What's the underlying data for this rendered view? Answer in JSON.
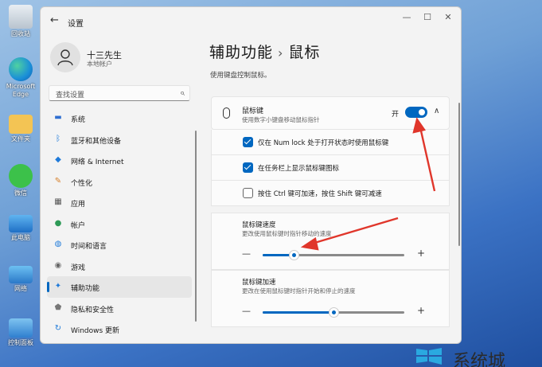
{
  "desktop": {
    "icons": [
      {
        "label": "回收站"
      },
      {
        "label": "Microsoft Edge"
      },
      {
        "label": "文件夹"
      },
      {
        "label": "微信"
      },
      {
        "label": "此电脑"
      },
      {
        "label": "网络"
      },
      {
        "label": "控制面板"
      }
    ]
  },
  "window": {
    "title": "设置",
    "back": "←",
    "minimize": "—",
    "maximize": "☐",
    "close": "✕"
  },
  "profile": {
    "name": "十三先生",
    "type": "本地帐户"
  },
  "search": {
    "placeholder": "查找设置"
  },
  "nav": {
    "items": [
      {
        "label": "系统",
        "icon": "monitor-icon",
        "color": "#2f6fd1"
      },
      {
        "label": "蓝牙和其他设备",
        "icon": "bluetooth-icon",
        "color": "#1f7ad9"
      },
      {
        "label": "网络 & Internet",
        "icon": "wifi-icon",
        "color": "#1f7ad9"
      },
      {
        "label": "个性化",
        "icon": "brush-icon",
        "color": "#d67f2a"
      },
      {
        "label": "应用",
        "icon": "apps-icon",
        "color": "#555"
      },
      {
        "label": "帐户",
        "icon": "person-icon",
        "color": "#2e9a57"
      },
      {
        "label": "时间和语言",
        "icon": "globe-icon",
        "color": "#1f7ad9"
      },
      {
        "label": "游戏",
        "icon": "gamepad-icon",
        "color": "#666"
      },
      {
        "label": "辅助功能",
        "icon": "accessibility-icon",
        "color": "#1f7ad9"
      },
      {
        "label": "隐私和安全性",
        "icon": "shield-icon",
        "color": "#777"
      },
      {
        "label": "Windows 更新",
        "icon": "update-icon",
        "color": "#1f7ad9"
      }
    ],
    "active_index": 8
  },
  "page": {
    "breadcrumb_parent": "辅助功能",
    "breadcrumb_sep": "›",
    "title": "鼠标",
    "subtitle": "使用键盘控制鼠标。"
  },
  "mouse_keys": {
    "title": "鼠标键",
    "description": "使用数字小键盘移动鼠标指针",
    "state_label": "开",
    "enabled": true,
    "chevron": "∧"
  },
  "options": [
    {
      "label": "仅在 Num lock 处于打开状态时使用鼠标键",
      "checked": true
    },
    {
      "label": "在任务栏上显示鼠标键图标",
      "checked": true
    },
    {
      "label": "按住 Ctrl 键可加速，按住 Shift 键可减速",
      "checked": false
    }
  ],
  "sliders": [
    {
      "title": "鼠标键速度",
      "description": "更改使用鼠标键时指针移动的速度",
      "value_fraction": 0.22
    },
    {
      "title": "鼠标键加速",
      "description": "更改在使用鼠标键时指针开始和停止的速度",
      "value_fraction": 0.5
    }
  ],
  "slider_minus": "—",
  "slider_plus": "+",
  "watermark": {
    "text": "系统城"
  },
  "colors": {
    "accent": "#0067c0",
    "annotation_arrow": "#e0362b"
  }
}
